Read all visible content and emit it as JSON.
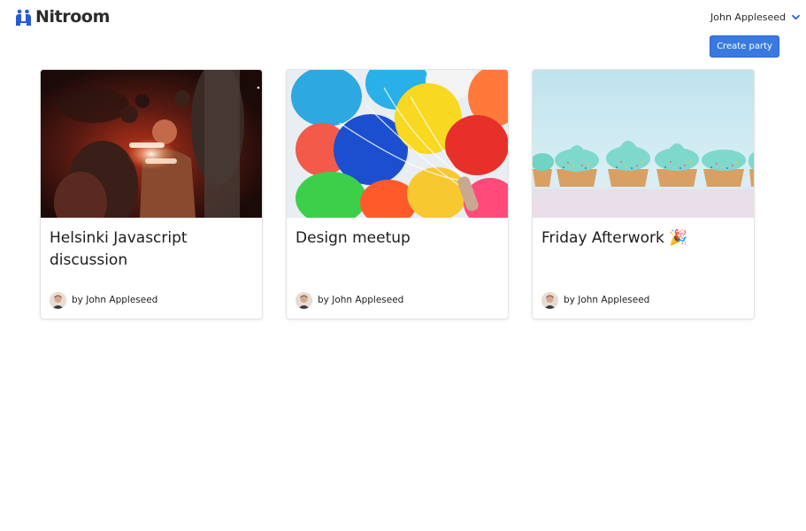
{
  "app": {
    "brand": "Nitroom",
    "accent_color": "#2a5bd7"
  },
  "header": {
    "user_name": "John Appleseed",
    "user_menu_icon": "chevron-down-icon"
  },
  "actions": {
    "create_party_label": "Create party"
  },
  "parties": [
    {
      "title": "Helsinki Javascript discussion",
      "author_line": "by John Appleseed",
      "image": "concert-crowd-photo"
    },
    {
      "title": "Design meetup",
      "author_line": "by John Appleseed",
      "image": "balloons-photo"
    },
    {
      "title": "Friday Afterwork 🎉",
      "author_line": "by John Appleseed",
      "image": "cupcakes-photo"
    }
  ]
}
